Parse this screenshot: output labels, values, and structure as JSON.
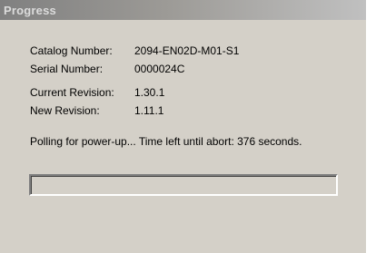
{
  "window": {
    "title": "Progress"
  },
  "info": [
    {
      "label": "Catalog Number:",
      "value": "2094-EN02D-M01-S1"
    },
    {
      "label": "Serial Number:",
      "value": "0000024C"
    },
    {
      "label": "Current Revision:",
      "value": "1.30.1"
    },
    {
      "label": "New Revision:",
      "value": "1.11.1"
    }
  ],
  "status": {
    "message": "Polling for power-up... Time left until abort: 376 seconds."
  },
  "progress": {
    "fraction": 0
  },
  "colors": {
    "window_bg": "#d4d0c8",
    "title_text": "#dcdcdc",
    "progress_fill": "#0a246a"
  }
}
